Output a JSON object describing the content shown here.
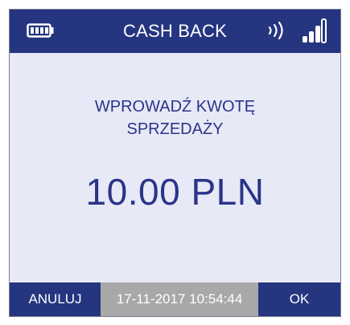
{
  "header": {
    "title": "CASH BACK",
    "icons": [
      "battery-icon",
      "contactless-icon",
      "signal-strength-icon"
    ]
  },
  "main": {
    "prompt_line1": "WPROWADŹ KWOTĘ",
    "prompt_line2": "SPRZEDAŻY",
    "amount": "10.00 PLN"
  },
  "footer": {
    "cancel_label": "ANULUJ",
    "datetime": "17-11-2017 10:54:44",
    "ok_label": "OK"
  },
  "colors": {
    "header_bg": "#253580",
    "screen_bg": "#e7e9f7",
    "text": "#2b3488",
    "datetime_bg": "#a8a8a8"
  }
}
